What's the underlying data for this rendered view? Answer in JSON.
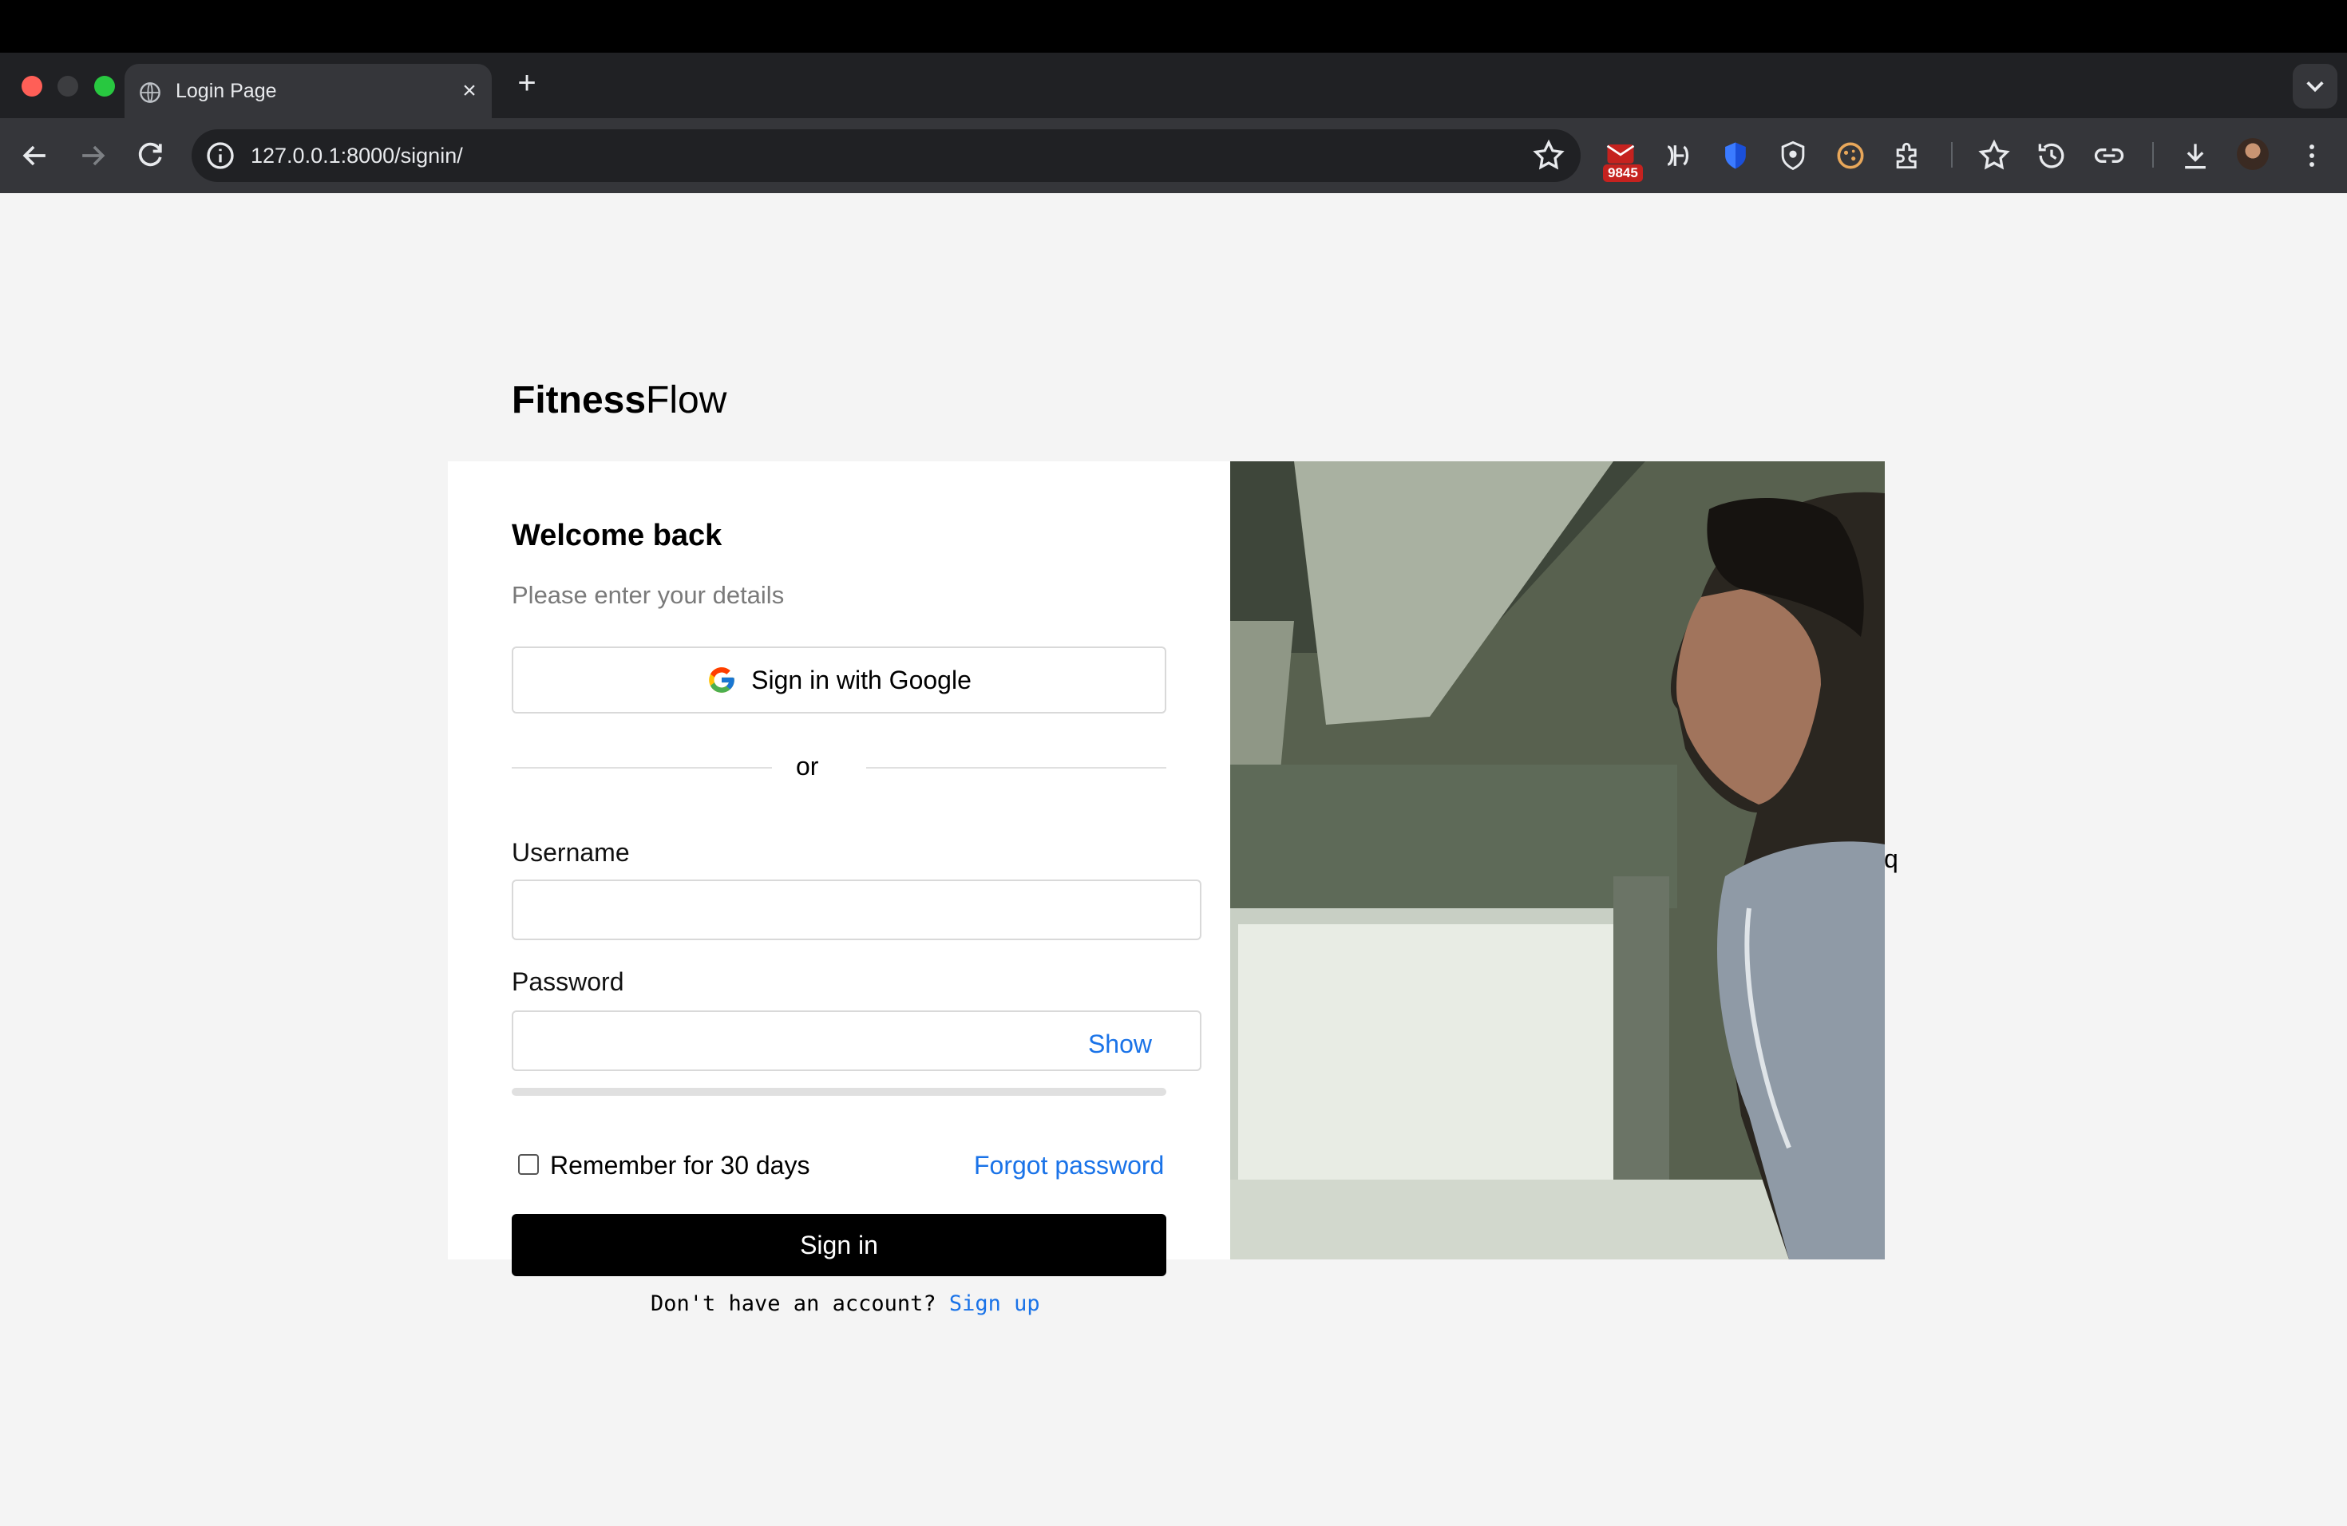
{
  "browser": {
    "tab_title": "Login Page",
    "url": "127.0.0.1:8000/signin/",
    "extension_badge": "9845"
  },
  "brand": {
    "strong": "Fitness",
    "light": "Flow"
  },
  "login": {
    "heading": "Welcome back",
    "subtitle": "Please enter your details",
    "google_button": "Sign in with Google",
    "divider": "or",
    "username_label": "Username",
    "username_value": "",
    "password_label": "Password",
    "password_value": "",
    "show_toggle": "Show",
    "remember_label": "Remember for 30 days",
    "remember_checked": false,
    "forgot_link": "Forgot password",
    "submit": "Sign in"
  },
  "stray_char": "q",
  "footer": {
    "prompt": "Don't have an account? ",
    "link": "Sign up"
  },
  "colors": {
    "accent": "#1a73e8",
    "button": "#000000",
    "background": "#f4f4f4"
  }
}
